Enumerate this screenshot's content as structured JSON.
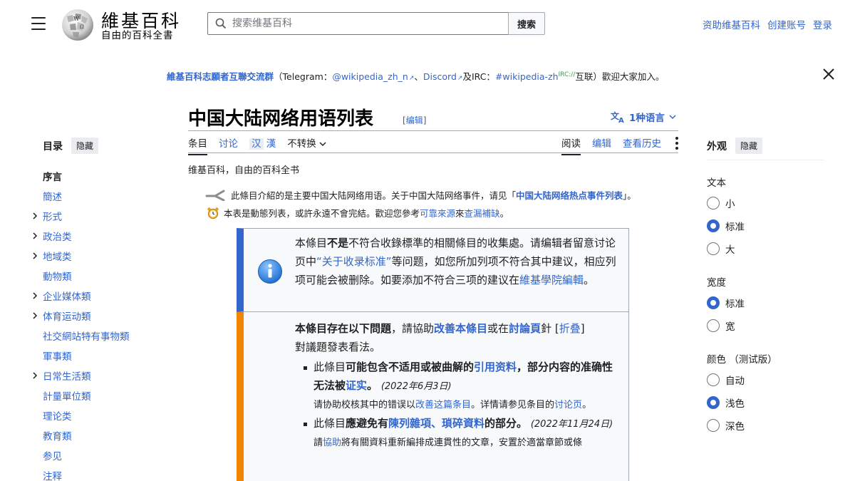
{
  "header": {
    "logo_title": "維基百科",
    "logo_subtitle": "自由的百科全書",
    "search_placeholder": "搜索维基百科",
    "search_button": "搜索",
    "top_links": [
      "资助维基百科",
      "创建账号",
      "登录"
    ]
  },
  "notice": {
    "group_link": "維基百科志願者互聯交流群",
    "open_paren": "（",
    "telegram_label": "Telegram：",
    "telegram_link": "@wikipedia_zh_n",
    "sep1": "、",
    "discord_link": "Discord",
    "and_text": "及",
    "irc_label": "IRC：",
    "irc_link": "#wikipedia-zh",
    "irc_sup": "IRC://",
    "tail": "互联）歡迎大家加入。"
  },
  "page": {
    "title": "中国大陆网络用语列表",
    "edit_bracket": "[编辑]",
    "languages": "1种语言"
  },
  "tabs": {
    "left": [
      {
        "label": "条目"
      },
      {
        "label": "讨论"
      },
      {
        "label": "汉"
      },
      {
        "label": "漢"
      },
      {
        "label": "不转换"
      }
    ],
    "right": [
      {
        "label": "阅读"
      },
      {
        "label": "编辑"
      },
      {
        "label": "查看历史"
      }
    ]
  },
  "site_subtitle": "维基百科，自由的百科全书",
  "hatnotes": {
    "h1_text": "此條目介紹的是主要中国大陆网络用语。关于中国大陆网络事件，请见「",
    "h1_link": "中国大陆网络热点事件列表",
    "h1_end": "」。",
    "h2_text": "本表是動態列表，或許永遠不會完結。歡迎您參考",
    "h2_link1": "可靠來源",
    "h2_mid": "來",
    "h2_link2": "查漏補缺",
    "h2_end": "。"
  },
  "ambox1": {
    "p1": "本條目",
    "bold": "不是",
    "p2": "不符合收錄標準的相關條目的收集處。请编辑者留意讨论页中",
    "link1": "“关于收录标准”",
    "p3": "等问题，如您所加列项不符合其中建议，相应列项可能会被删除。如要添加不符合三项的建议在",
    "link2": "維基學院編輯",
    "p4": "。"
  },
  "ambox2": {
    "lead_bold": "本條目存在以下問題",
    "lead_1": "，請協助",
    "lead_link1": "改善本條目",
    "lead_2": "或在",
    "lead_link2": "討論頁",
    "lead_3": "針",
    "fold_open": "[",
    "fold_link": "折叠",
    "fold_close": "]",
    "lead_4": "對議題發表看法。",
    "item1_a": "此條目",
    "item1_bold": "可能包含不适用或被曲解的",
    "item1_link": "引用资料",
    "item1_bold2": "，部分内容的准确性无法被",
    "item1_link2": "证实",
    "item1_b": "。",
    "item1_date": "(2022年6月3日)",
    "item1_small_a": "请协助校核其中的错误以",
    "item1_small_link": "改善这篇条目",
    "item1_small_b": "。详情请参见条目的",
    "item1_small_link2": "讨论页",
    "item1_small_c": "。",
    "item2_a": "此條目",
    "item2_bold": "應避免有",
    "item2_link": "陳列雜項、瑣碎資料",
    "item2_bold2": "的部分。",
    "item2_date": "(2022年11月24日)",
    "item2_small_a": "請",
    "item2_small_link": "協助",
    "item2_small_b": "將有關資料重新編排成連貫性的文章，安置於適當章節或條"
  },
  "toc": {
    "title": "目录",
    "hide": "隐藏",
    "items": [
      {
        "label": "序言",
        "active": true,
        "chevron": false
      },
      {
        "label": "簡述",
        "chevron": false
      },
      {
        "label": "形式",
        "chevron": true
      },
      {
        "label": "政治类",
        "chevron": true
      },
      {
        "label": "地域类",
        "chevron": true
      },
      {
        "label": "動物類",
        "chevron": false
      },
      {
        "label": "企业媒体類",
        "chevron": true
      },
      {
        "label": "体育运动類",
        "chevron": true
      },
      {
        "label": "社交網站特有事物類",
        "chevron": false
      },
      {
        "label": "軍事類",
        "chevron": false
      },
      {
        "label": "日常生活類",
        "chevron": true
      },
      {
        "label": "計量單位類",
        "chevron": false
      },
      {
        "label": "理论类",
        "chevron": false
      },
      {
        "label": "教育類",
        "chevron": false
      },
      {
        "label": "参见",
        "chevron": false
      },
      {
        "label": "注释",
        "chevron": false
      }
    ]
  },
  "appearance": {
    "title": "外观",
    "hide": "隐藏",
    "text_label": "文本",
    "text_options": [
      "小",
      "标准",
      "大"
    ],
    "text_selected": "标准",
    "width_label": "宽度",
    "width_options": [
      "标准",
      "宽"
    ],
    "width_selected": "标准",
    "color_label": "颜色 （测试版）",
    "color_options": [
      "自动",
      "浅色",
      "深色"
    ],
    "color_selected": "浅色"
  },
  "colors": {
    "link": "#3366cc",
    "info_blue": "#36c",
    "issue_orange": "#f28500"
  }
}
